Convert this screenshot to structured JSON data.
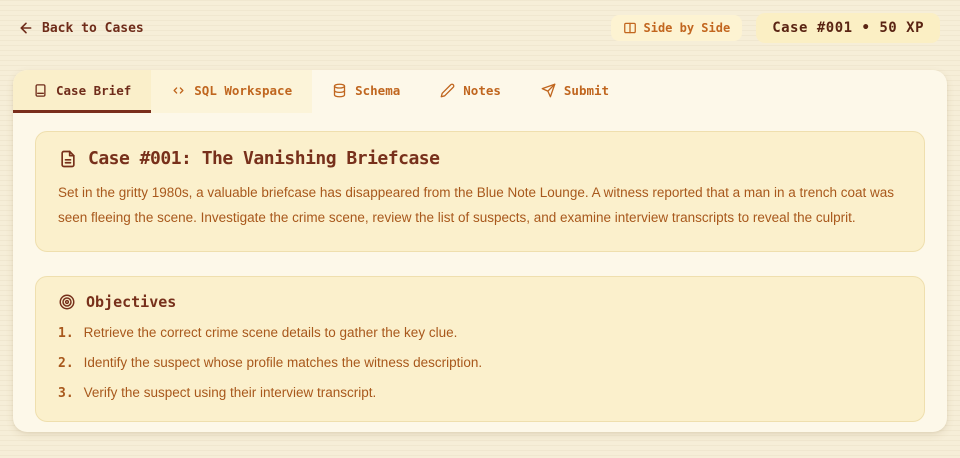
{
  "colors": {
    "page_bg": "#f6eed8",
    "card_bg": "#fdf8e9",
    "panel_bg": "#fbf0cc",
    "panel_border": "#efdfae",
    "maroon": "#6f2c1a",
    "rust": "#a8581c",
    "orange": "#c0661f",
    "active_tab_bg": "#faefca",
    "active_tab_underline": "#7a2e1c",
    "badge_bg": "#fbefc4"
  },
  "header": {
    "back_label": "Back to Cases",
    "side_by_side_label": "Side by Side",
    "case_badge": "Case #001 • 50 XP"
  },
  "tabs": [
    {
      "label": "Case Brief",
      "icon": "book-icon",
      "active": true
    },
    {
      "label": "SQL Workspace",
      "icon": "code-icon",
      "active": false
    },
    {
      "label": "Schema",
      "icon": "database-icon",
      "active": false
    },
    {
      "label": "Notes",
      "icon": "pencil-icon",
      "active": false
    },
    {
      "label": "Submit",
      "icon": "send-icon",
      "active": false
    }
  ],
  "brief": {
    "title": "Case #001: The Vanishing Briefcase",
    "description": "Set in the gritty 1980s, a valuable briefcase has disappeared from the Blue Note Lounge. A witness reported that a man in a trench coat was seen fleeing the scene. Investigate the crime scene, review the list of suspects, and examine interview transcripts to reveal the culprit."
  },
  "objectives": {
    "title": "Objectives",
    "items": [
      {
        "num": "1.",
        "text": "Retrieve the correct crime scene details to gather the key clue."
      },
      {
        "num": "2.",
        "text": "Identify the suspect whose profile matches the witness description."
      },
      {
        "num": "3.",
        "text": "Verify the suspect using their interview transcript."
      }
    ]
  }
}
